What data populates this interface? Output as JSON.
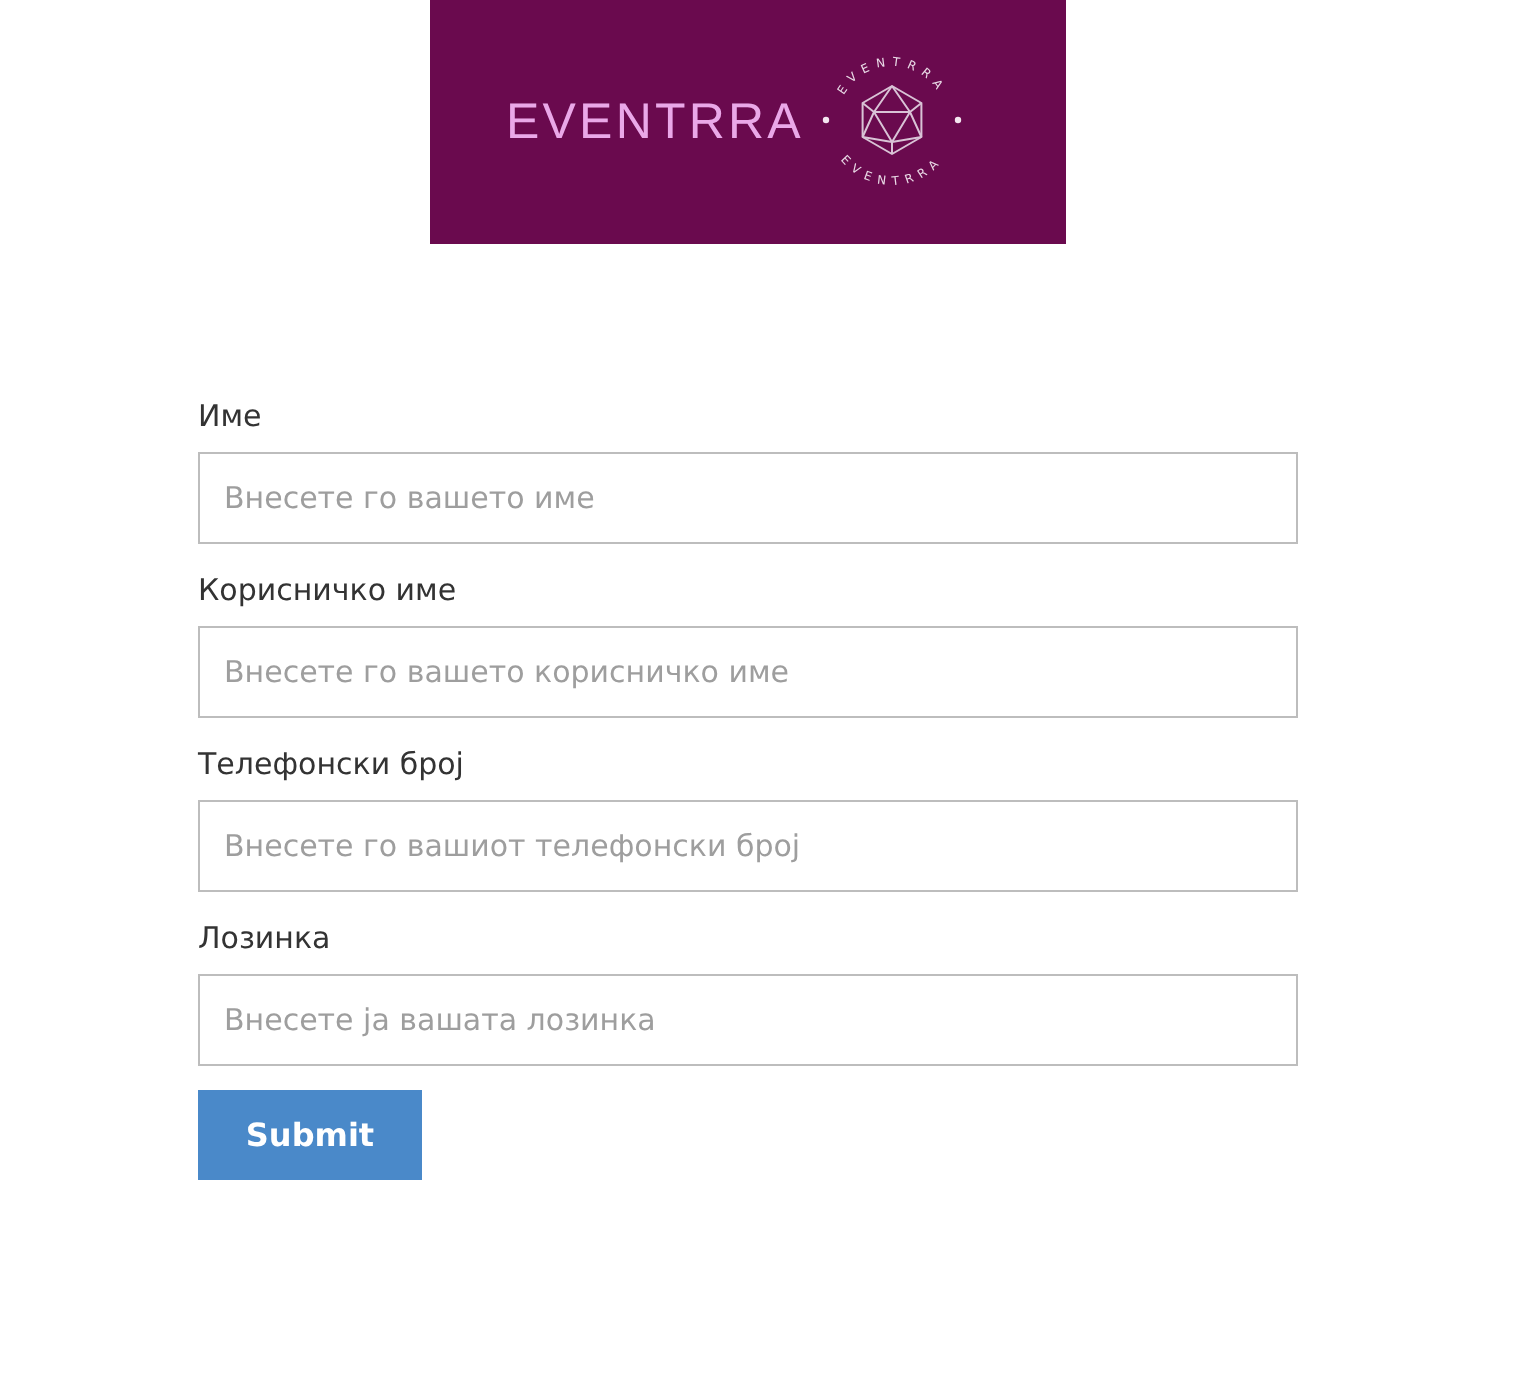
{
  "logo": {
    "wordmark": "EVENTRRA",
    "ring_text": [
      "EVENTRRA",
      "EVENTRRA"
    ]
  },
  "form": {
    "fields": [
      {
        "label": "Име",
        "placeholder": "Внесете го вашето име"
      },
      {
        "label": "Корисничко име",
        "placeholder": "Внесете го вашето корисничко име"
      },
      {
        "label": "Телефонски број",
        "placeholder": "Внесете го вашиот телефонски број"
      },
      {
        "label": "Лозинка",
        "placeholder": "Внесете ја вашата лозинка"
      }
    ],
    "submit": "Submit"
  }
}
